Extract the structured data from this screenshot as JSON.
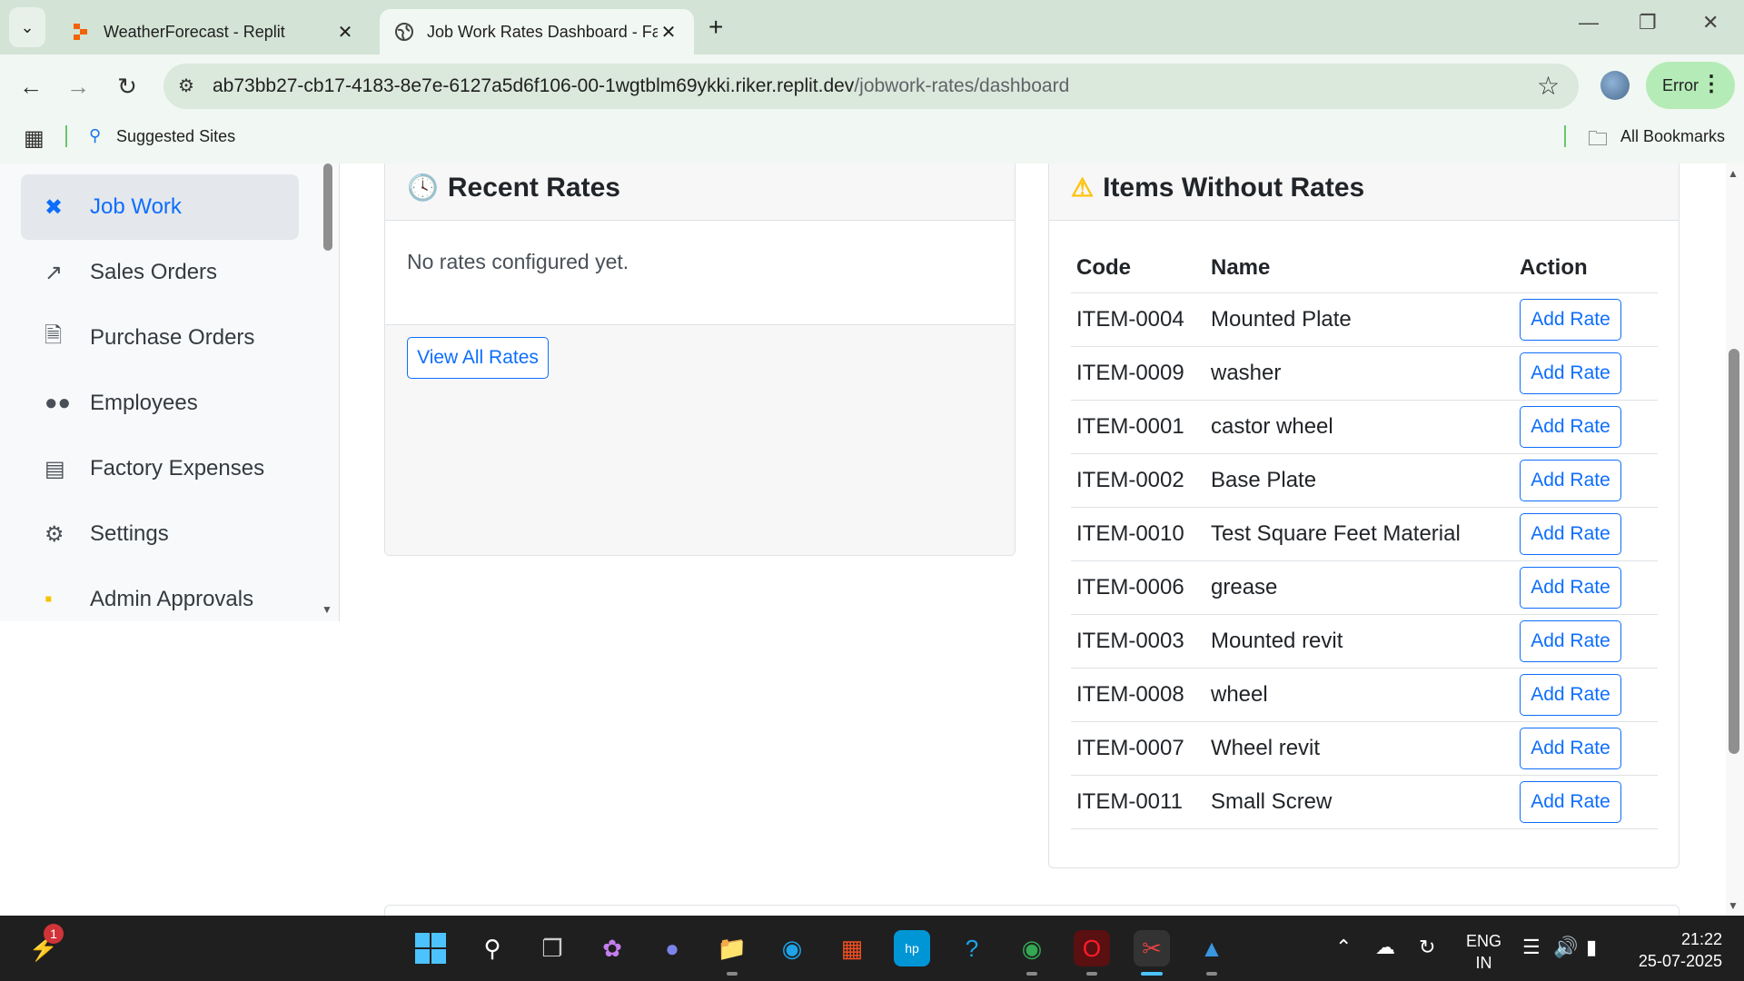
{
  "browser": {
    "tabs": [
      {
        "title": "WeatherForecast - Replit",
        "active": false
      },
      {
        "title": "Job Work Rates Dashboard - Fa",
        "active": true
      }
    ],
    "url_host": "ab73bb27-cb17-4183-8e7e-6127a5d6f106-00-1wgtblm69ykki.riker.replit.dev",
    "url_path": "/jobwork-rates/dashboard",
    "profile_status": "Error",
    "bookmarks": {
      "suggested": "Suggested Sites",
      "all": "All Bookmarks"
    }
  },
  "sidebar": {
    "items": [
      {
        "label": "Job Work",
        "icon": "tools-icon",
        "active": true
      },
      {
        "label": "Sales Orders",
        "icon": "chart-line-icon",
        "active": false
      },
      {
        "label": "Purchase Orders",
        "icon": "file-invoice-icon",
        "active": false
      },
      {
        "label": "Employees",
        "icon": "users-icon",
        "active": false
      },
      {
        "label": "Factory Expenses",
        "icon": "receipt-icon",
        "active": false
      },
      {
        "label": "Settings",
        "icon": "gear-icon",
        "active": false
      },
      {
        "label": "Admin Approvals",
        "icon": "clipboard-check-icon",
        "active": false
      }
    ]
  },
  "recent_rates": {
    "title": "Recent Rates",
    "empty_text": "No rates configured yet.",
    "view_all_label": "View All Rates"
  },
  "items_without_rates": {
    "title": "Items Without Rates",
    "columns": [
      "Code",
      "Name",
      "Action"
    ],
    "action_label": "Add Rate",
    "rows": [
      {
        "code": "ITEM-0004",
        "name": "Mounted Plate"
      },
      {
        "code": "ITEM-0009",
        "name": "washer"
      },
      {
        "code": "ITEM-0001",
        "name": "castor wheel"
      },
      {
        "code": "ITEM-0002",
        "name": "Base Plate"
      },
      {
        "code": "ITEM-0010",
        "name": "Test Square Feet Material"
      },
      {
        "code": "ITEM-0006",
        "name": "grease"
      },
      {
        "code": "ITEM-0003",
        "name": "Mounted revit"
      },
      {
        "code": "ITEM-0008",
        "name": "wheel"
      },
      {
        "code": "ITEM-0007",
        "name": "Wheel revit"
      },
      {
        "code": "ITEM-0011",
        "name": "Small Screw"
      }
    ]
  },
  "taskbar": {
    "notification_count": "1",
    "language": "ENG",
    "region": "IN",
    "time": "21:22",
    "date": "25-07-2025"
  },
  "colors": {
    "primary": "#0d6efd",
    "warning": "#ffc107",
    "chrome_bg": "#d3e3d5"
  }
}
